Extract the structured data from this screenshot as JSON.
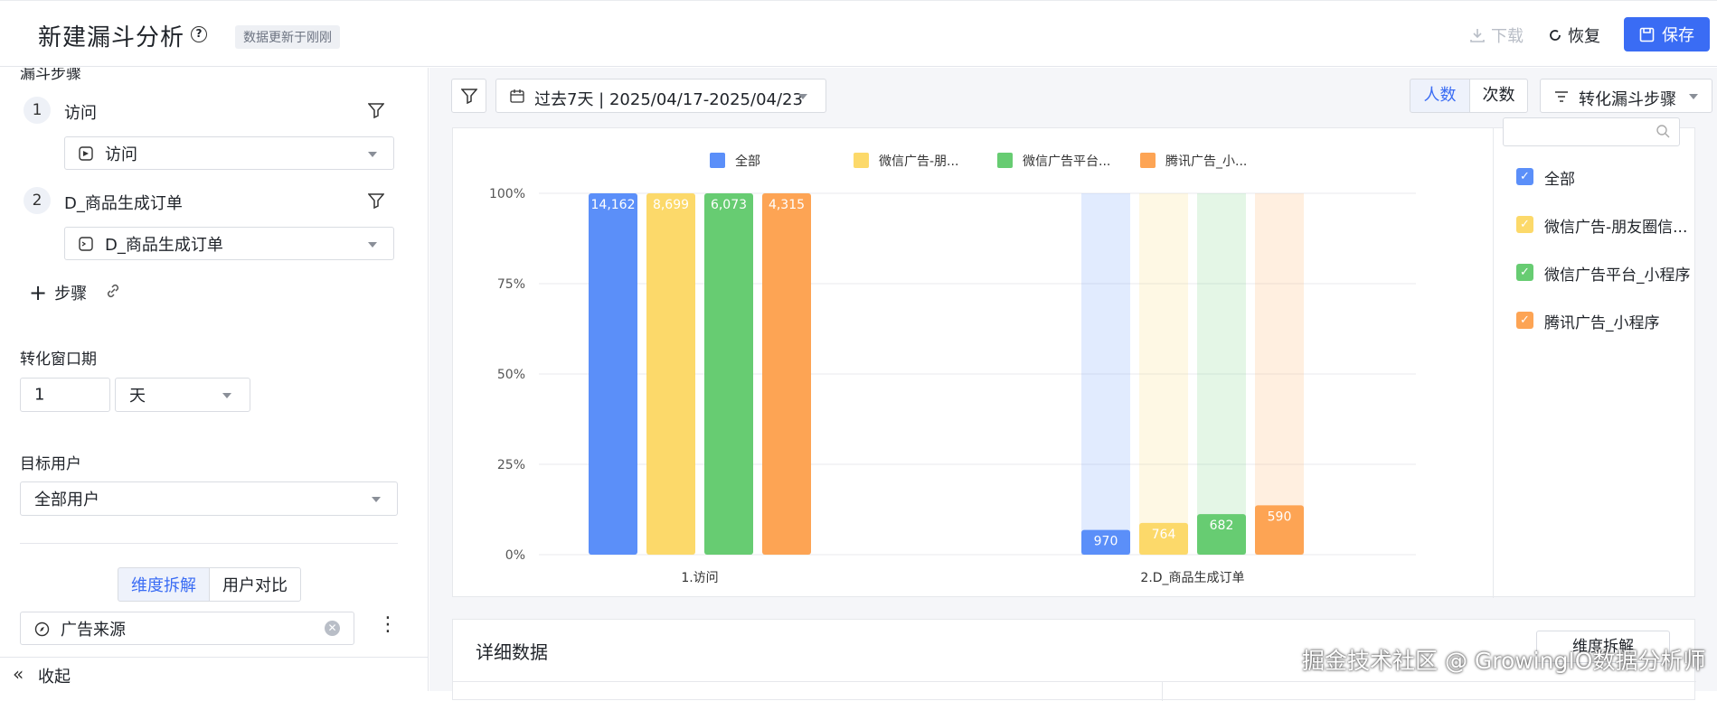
{
  "header": {
    "title": "新建漏斗分析",
    "update_badge": "数据更新于刚刚",
    "download_label": "下载",
    "restore_label": "恢复",
    "save_label": "保存"
  },
  "left": {
    "steps_title": "漏斗步骤",
    "steps": [
      {
        "num": "1",
        "name": "访问",
        "event": "访问"
      },
      {
        "num": "2",
        "name": "D_商品生成订单",
        "event": "D_商品生成订单"
      }
    ],
    "add_step_label": "步骤",
    "window_title": "转化窗口期",
    "window_value": "1",
    "window_unit": "天",
    "target_title": "目标用户",
    "target_value": "全部用户",
    "tab_dimension": "维度拆解",
    "tab_compare": "用户对比",
    "dimension_value": "广告来源",
    "collapse_label": "收起"
  },
  "toolbar": {
    "date_range": "过去7天 | 2025/04/17-2025/04/23",
    "metric_people": "人数",
    "metric_times": "次数",
    "funnel_mode": "转化漏斗步骤"
  },
  "chart_data": {
    "type": "bar",
    "categories": [
      "1.访问",
      "2.D_商品生成订单"
    ],
    "series": [
      {
        "name": "全部",
        "color": "#5b8ff9",
        "values": [
          14162,
          970
        ],
        "percent": [
          100,
          6.85
        ]
      },
      {
        "name": "微信广告-朋友圈信...",
        "legend_short": "微信广告-朋...",
        "color": "#fcd96a",
        "values": [
          8699,
          764
        ],
        "percent": [
          100,
          8.78
        ]
      },
      {
        "name": "微信广告平台_小程序",
        "legend_short": "微信广告平台...",
        "color": "#67cc72",
        "values": [
          6073,
          682
        ],
        "percent": [
          100,
          11.23
        ]
      },
      {
        "name": "腾讯广告_小程序",
        "legend_short": "腾讯广告_小...",
        "color": "#fda454",
        "values": [
          4315,
          590
        ],
        "percent": [
          100,
          13.67
        ]
      }
    ],
    "y_ticks": [
      "0%",
      "25%",
      "50%",
      "75%",
      "100%"
    ],
    "ylim": [
      0,
      100
    ],
    "grid": true,
    "legend": "top"
  },
  "detail": {
    "title": "详细数据",
    "button": "维度拆解"
  },
  "watermark": "掘金技术社区 @ GrowingIO数据分析师"
}
